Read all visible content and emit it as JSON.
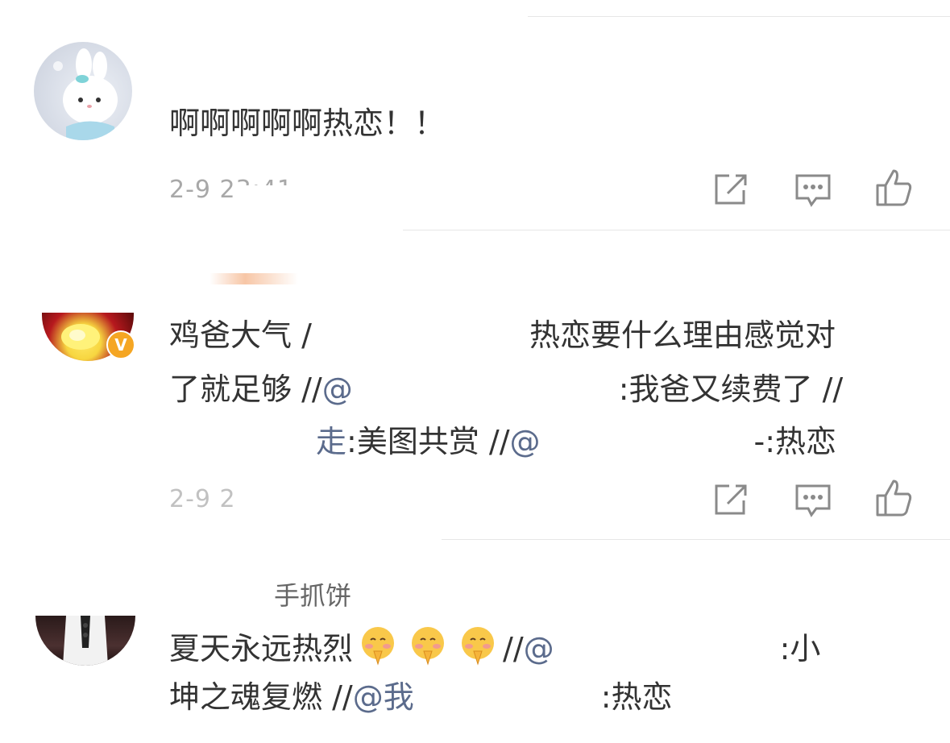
{
  "comments": [
    {
      "avatar_icon": "bunny-plush-avatar",
      "text": "啊啊啊啊啊热恋！！",
      "time": "2-9 23:41"
    },
    {
      "avatar_icon": "flower-avatar",
      "verified_badge": "V",
      "verified_color": "#f5a623",
      "lines": [
        {
          "parts": [
            "鸡爸大气 / ",
            "热恋要什么理由感觉对"
          ]
        },
        {
          "parts": [
            "了就足够 //",
            "@",
            ":我爸又续费了 //"
          ]
        },
        {
          "parts": [
            "走",
            ":美图共赏 //",
            "@",
            "-:热恋"
          ]
        }
      ],
      "time": "2-9 2"
    },
    {
      "avatar_icon": "portrait-avatar",
      "username_fragment": "手抓饼",
      "lines": [
        {
          "parts": [
            "夏天永远热烈",
            "//",
            "@",
            ":小"
          ]
        },
        {
          "parts": [
            "坤之魂复燃 //",
            "@我",
            ":热恋"
          ]
        }
      ]
    }
  ],
  "actions": {
    "share_icon": "share-icon",
    "comment_icon": "comment-icon",
    "like_icon": "thumbs-up-icon"
  },
  "emoji_name": "shy-praying-face-emoji",
  "colors": {
    "text": "#333333",
    "mention": "#5b6b8c",
    "time": "#a8a8a8",
    "icon": "#8a8a8a",
    "divider": "#e6e6e6"
  }
}
